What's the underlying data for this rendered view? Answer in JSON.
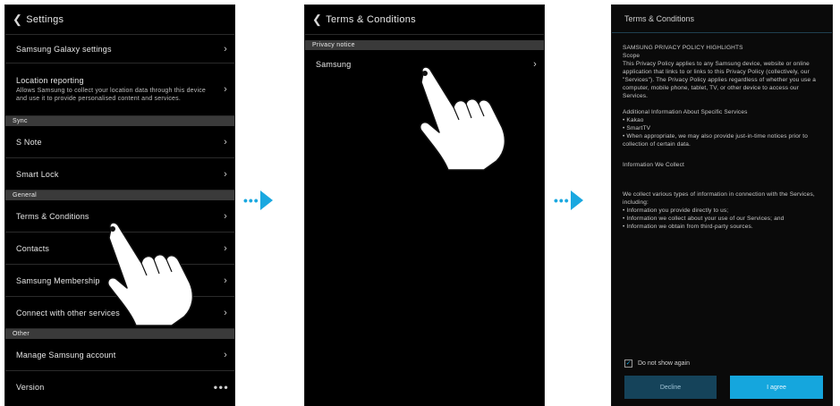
{
  "screen1": {
    "title": "Settings",
    "rows_top": [
      {
        "label": "Samsung Galaxy settings"
      },
      {
        "label": "Location reporting",
        "sub": "Allows Samsung to collect your location data through this device and use it to provide personalised content and services."
      }
    ],
    "section_main": "Sync",
    "rows_sync": [
      {
        "label": "S Note"
      },
      {
        "label": "Smart Lock"
      }
    ],
    "section_general": "General",
    "rows_general": [
      {
        "label": "Terms & Conditions"
      },
      {
        "label": "Contacts"
      },
      {
        "label": "Samsung Membership"
      },
      {
        "label": "Connect with other services"
      }
    ],
    "section_other": "Other",
    "rows_other": [
      {
        "label": "Manage Samsung account"
      },
      {
        "label": "Version"
      }
    ]
  },
  "screen2": {
    "title": "Terms & Conditions",
    "section": "Privacy notice",
    "rows": [
      {
        "label": "Samsung"
      }
    ]
  },
  "screen3": {
    "title": "Terms & Conditions",
    "paragraphs": [
      "SAMSUNG PRIVACY POLICY HIGHLIGHTS",
      "Scope",
      "This Privacy Policy applies to any Samsung device, website or online application that links to or links to this Privacy Policy (collectively, our \"Services\"). The Privacy Policy applies regardless of whether you use a computer, mobile phone, tablet, TV, or other device to access our Services.",
      "Additional Information About Specific Services",
      "• Kakao\n• SmartTV\n• When appropriate, we may also provide just-in-time notices prior to collection of certain data.",
      "Information We Collect",
      "We collect various types of information in connection with the Services, including:\n• Information you provide directly to us;\n• Information we collect about your use of our Services; and\n• Information we obtain from third-party sources."
    ],
    "checkbox_label": "Do not show again",
    "decline_label": "Decline",
    "agree_label": "I agree"
  },
  "colors": {
    "accent": "#1aa8e0",
    "phone_bg": "#000000"
  }
}
